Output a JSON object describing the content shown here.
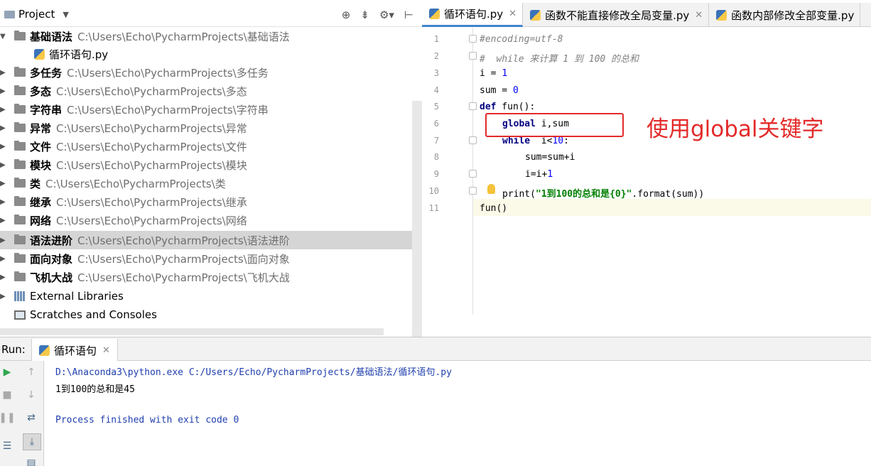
{
  "project_panel": {
    "title": "Project",
    "tree": [
      {
        "name": "基础语法",
        "path": "C:\\Users\\Echo\\PycharmProjects\\基础语法",
        "expanded": true
      },
      {
        "name": "循环语句.py",
        "path": "",
        "file": true
      },
      {
        "name": "多任务",
        "path": "C:\\Users\\Echo\\PycharmProjects\\多任务"
      },
      {
        "name": "多态",
        "path": "C:\\Users\\Echo\\PycharmProjects\\多态"
      },
      {
        "name": "字符串",
        "path": "C:\\Users\\Echo\\PycharmProjects\\字符串"
      },
      {
        "name": "异常",
        "path": "C:\\Users\\Echo\\PycharmProjects\\异常"
      },
      {
        "name": "文件",
        "path": "C:\\Users\\Echo\\PycharmProjects\\文件"
      },
      {
        "name": "模块",
        "path": "C:\\Users\\Echo\\PycharmProjects\\模块"
      },
      {
        "name": "类",
        "path": "C:\\Users\\Echo\\PycharmProjects\\类"
      },
      {
        "name": "继承",
        "path": "C:\\Users\\Echo\\PycharmProjects\\继承"
      },
      {
        "name": "网络",
        "path": "C:\\Users\\Echo\\PycharmProjects\\网络"
      },
      {
        "name": "语法进阶",
        "path": "C:\\Users\\Echo\\PycharmProjects\\语法进阶",
        "selected": true
      },
      {
        "name": "面向对象",
        "path": "C:\\Users\\Echo\\PycharmProjects\\面向对象"
      },
      {
        "name": "飞机大战",
        "path": "C:\\Users\\Echo\\PycharmProjects\\飞机大战"
      },
      {
        "name": "External Libraries",
        "path": "",
        "libs": true
      },
      {
        "name": "Scratches and Consoles",
        "path": "",
        "scratch": true
      }
    ]
  },
  "editor": {
    "tabs": [
      {
        "label": "循环语句.py",
        "active": true
      },
      {
        "label": "函数不能直接修改全局变量.py",
        "active": false
      },
      {
        "label": "函数内部修改全部变量.py",
        "active": false
      }
    ],
    "line_numbers": [
      "1",
      "2",
      "3",
      "4",
      "5",
      "6",
      "7",
      "8",
      "9",
      "10",
      "11"
    ],
    "lines": {
      "l1": "#encoding=utf-8",
      "l2": "#  while 来计算 1 到 100 的总和",
      "l3a": "i = ",
      "l3b": "1",
      "l4a": "sum = ",
      "l4b": "0",
      "l5a": "def",
      "l5b": " fun():",
      "l6a": "global",
      "l6b": " i,sum",
      "l7a": "while",
      "l7b": "  i<",
      "l7c": "10",
      "l7d": ":",
      "l8": "sum=sum+i",
      "l9a": "i=i+",
      "l9b": "1",
      "l10a": "print(",
      "l10b": "\"1到100的总和是{0}\"",
      "l10c": ".format(sum))",
      "l11": "fun()"
    },
    "annotation": "使用global关键字"
  },
  "run_panel": {
    "label": "Run:",
    "tab": "循环语句",
    "output": [
      "D:\\Anaconda3\\python.exe C:/Users/Echo/PycharmProjects/基础语法/循环语句.py",
      "1到100的总和是45",
      "",
      "Process finished with exit code 0"
    ]
  },
  "colors": {
    "accent": "#4083c9",
    "annotation_red": "#e32a2a",
    "run_green": "#2fa84f",
    "console_path_blue": "#1f3fae"
  }
}
